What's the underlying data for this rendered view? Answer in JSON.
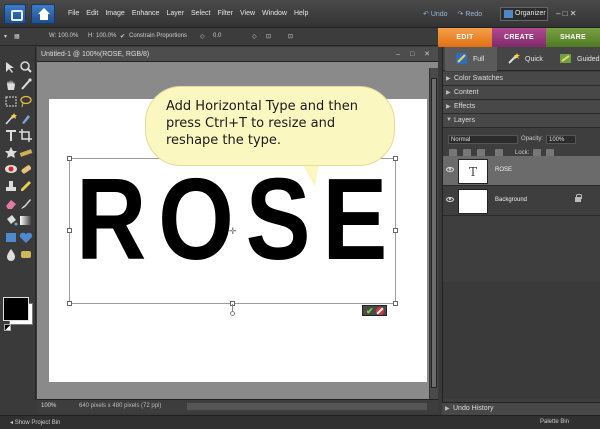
{
  "menu": {
    "items": [
      "File",
      "Edit",
      "Image",
      "Enhance",
      "Layer",
      "Select",
      "Filter",
      "View",
      "Window",
      "Help"
    ],
    "undo_label": "Undo",
    "redo_label": "Redo",
    "organizer_label": "Organizer",
    "window_controls": "–  □  ✕"
  },
  "options_bar": {
    "w_label": "W:",
    "w_value": "100.0%",
    "h_label": "H:",
    "h_value": "100.0%",
    "constrain_label": "Constrain Proportions",
    "angle_value": "0.0"
  },
  "mode_tabs": {
    "edit": "EDIT",
    "create": "CREATE",
    "share": "SHARE"
  },
  "document": {
    "title": "Untitled-1 @ 100%(ROSE, RGB/8)",
    "window_controls": "–  □  ✕",
    "canvas_text": "ROSE",
    "zoom": "100%",
    "info": "640 pixels x 480 pixels (72 ppi)"
  },
  "callout": {
    "text": "Add Horizontal Type and then press Ctrl+T to resize and reshape the type."
  },
  "panel": {
    "tabs": {
      "full": "Full",
      "quick": "Quick",
      "guided": "Guided"
    },
    "sections": {
      "color_swatches": "Color Swatches",
      "content": "Content",
      "effects": "Effects",
      "layers": "Layers"
    },
    "layer_options": {
      "blend_mode": "Normal",
      "opacity_label": "Opacity:",
      "opacity_value": "100%",
      "lock_label": "Lock:"
    },
    "layers": [
      {
        "name": "ROSE",
        "thumb": "T"
      },
      {
        "name": "Background"
      }
    ],
    "undo_history": "Undo History"
  },
  "bottom_bar": {
    "show_project_bin": "Show Project Bin",
    "palette_bin": "Palette Bin"
  },
  "colors": {
    "accent_edit": "#e8801e",
    "accent_create": "#9a3a80",
    "accent_share": "#628c30",
    "callout_bg": "#fbf7c0",
    "foreground_color": "#000000",
    "background_color": "#ffffff"
  }
}
